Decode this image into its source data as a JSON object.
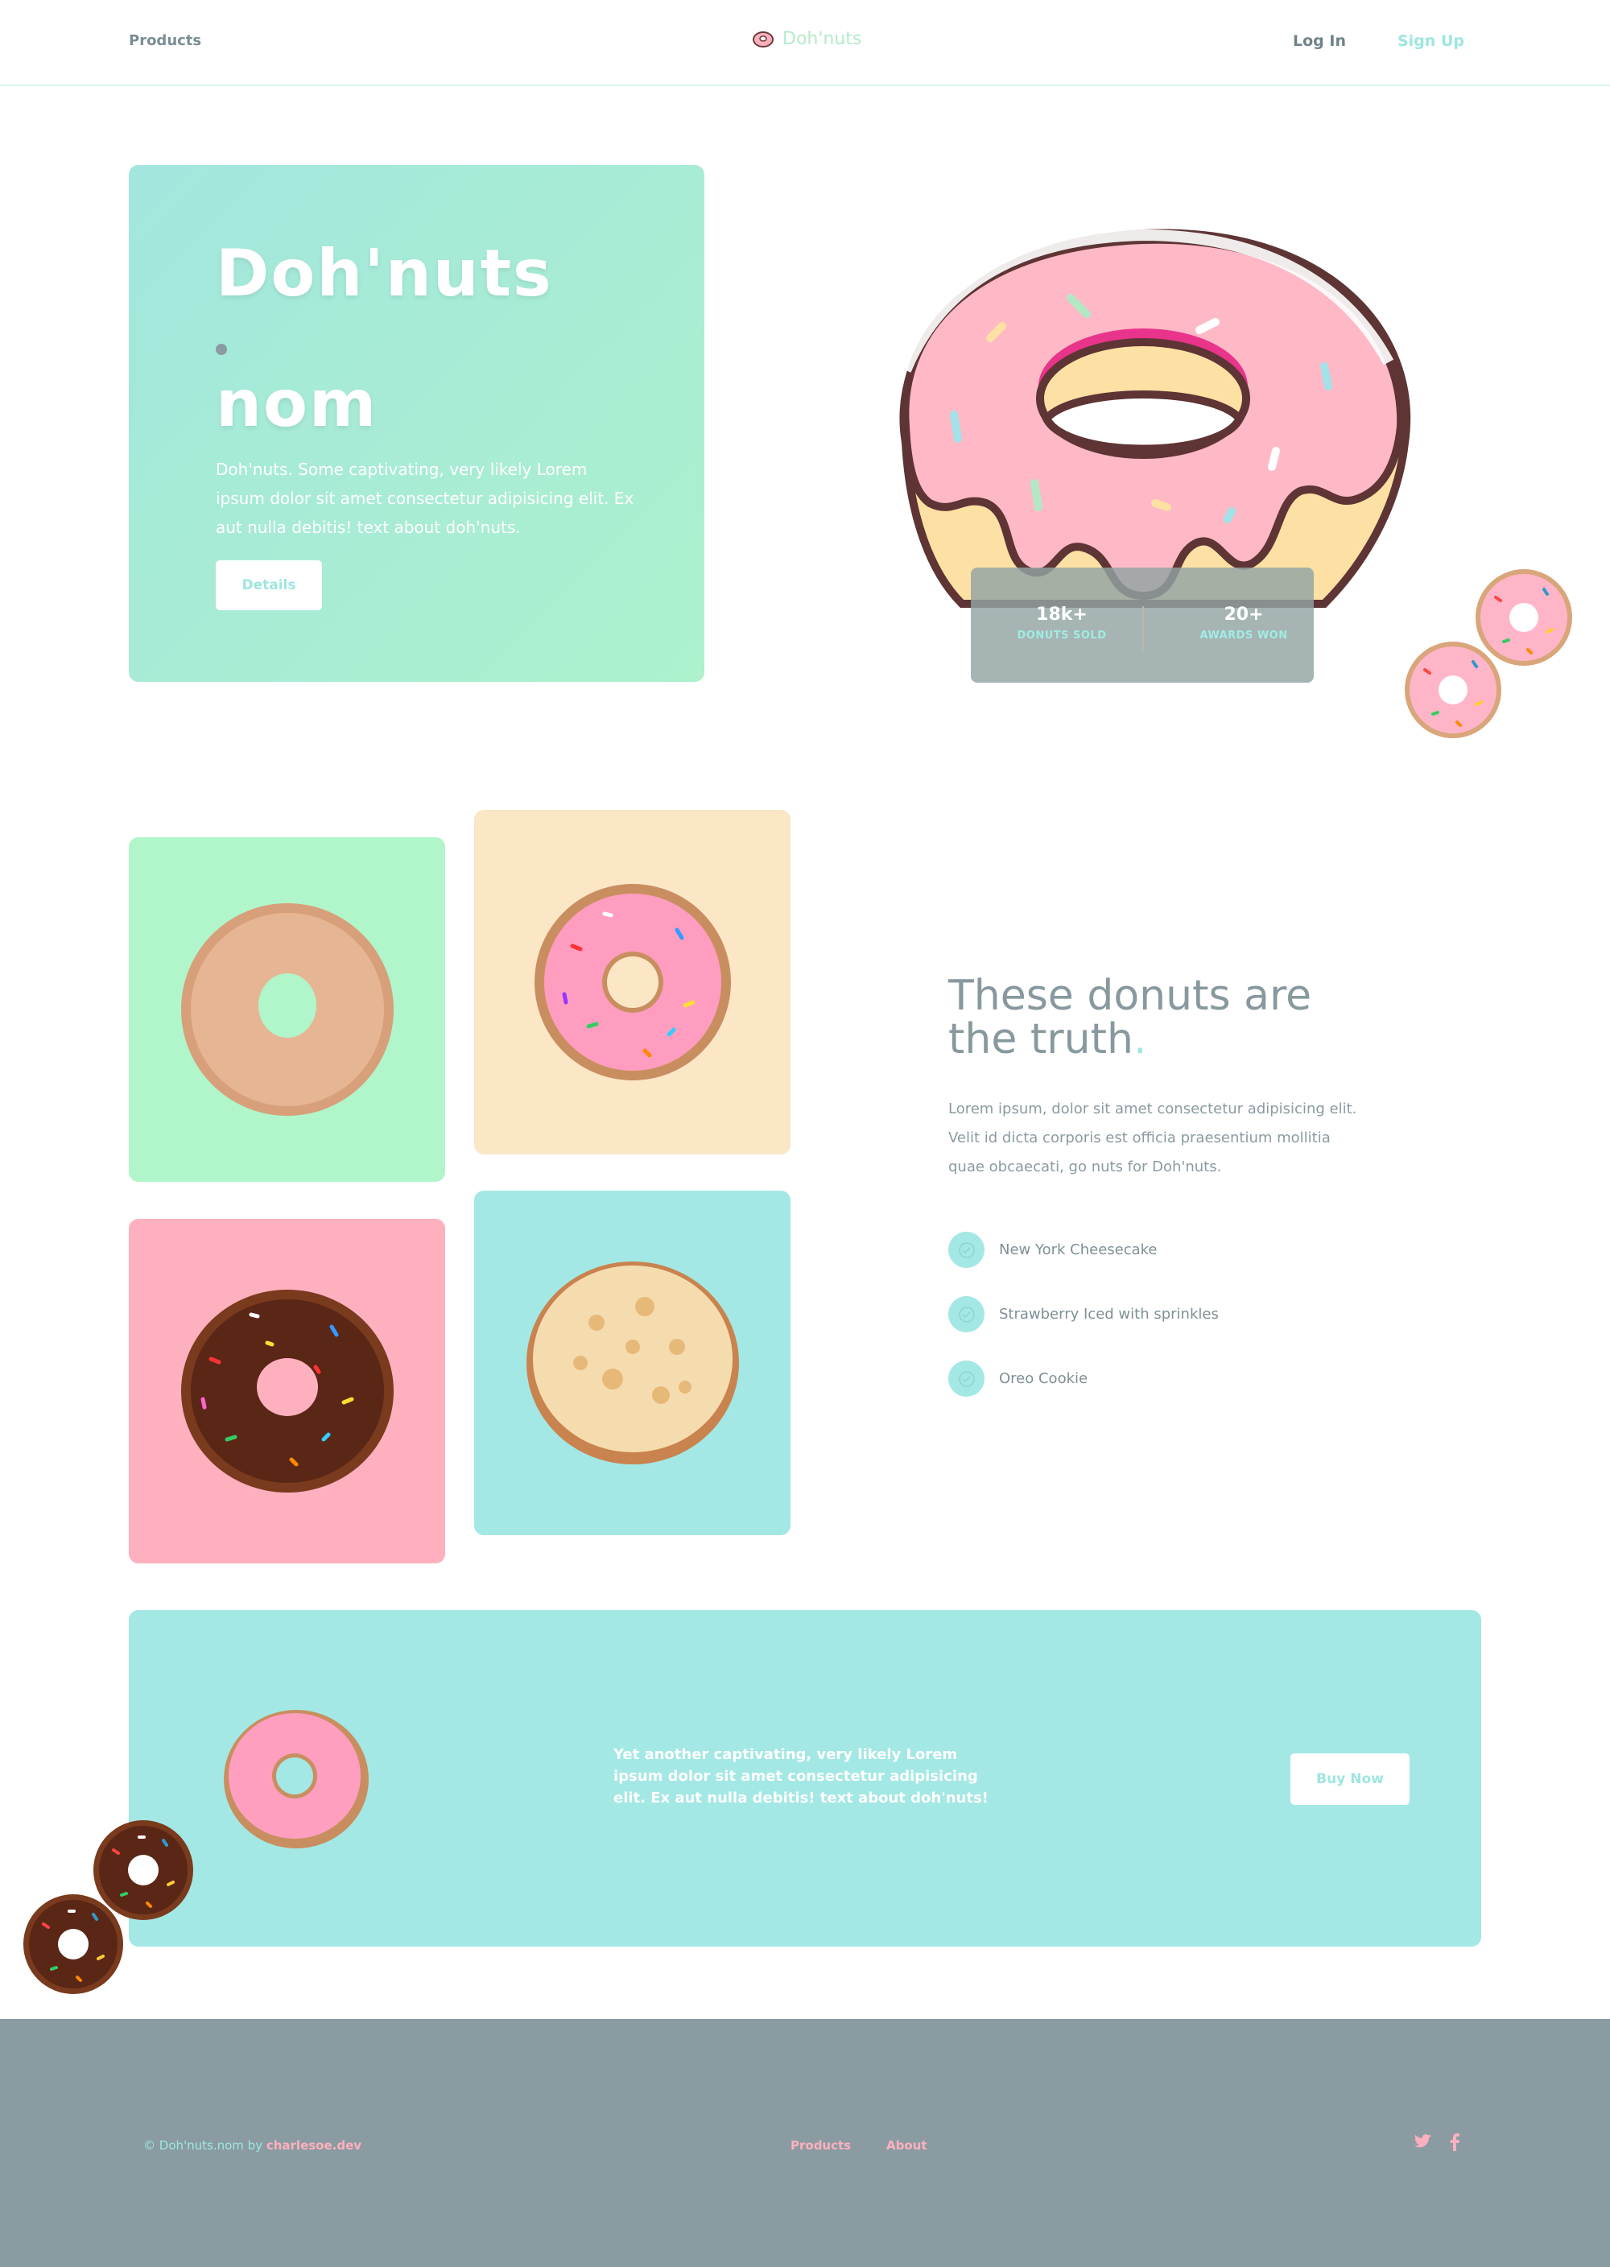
{
  "nav": {
    "products": "Products",
    "brand": "Doh'nuts",
    "login": "Log In",
    "signup": "Sign Up"
  },
  "hero": {
    "title": "Doh'nuts",
    "subtitle": "nom",
    "text": "Doh'nuts. Some captivating, very likely Lorem ipsum dolor sit amet consectetur adipisicing elit. Ex aut nulla debitis! text about doh'nuts.",
    "details_label": "Details"
  },
  "stats": [
    {
      "value": "18k+",
      "label": "DONUTS SOLD"
    },
    {
      "value": "20+",
      "label": "AWARDS WON"
    }
  ],
  "truth": {
    "title": "These donuts are the truth",
    "title_accent": ".",
    "text": "Lorem ipsum, dolor sit amet consectetur adipisicing elit. Velit id dicta corporis est officia praesentium mollitia quae obcaecati, go nuts for Doh'nuts.",
    "flavors": [
      "New York Cheesecake",
      "Strawberry Iced with sprinkles",
      "Oreo Cookie"
    ]
  },
  "cta": {
    "text": "Yet another captivating, very likely Lorem ipsum dolor sit amet consectetur adipisicing elit. Ex aut nulla debitis! text about doh'nuts!",
    "buy_label": "Buy Now"
  },
  "footer": {
    "copyright_prefix": "© Doh'nuts.nom by ",
    "author": "charlesoe.dev",
    "links": [
      "Products",
      "About"
    ]
  },
  "colors": {
    "mint": "#a3e8e4",
    "green": "#b1f5ca",
    "pink": "#ffb0bf",
    "cream": "#fbe6c6",
    "slate": "#8a9ca2"
  }
}
